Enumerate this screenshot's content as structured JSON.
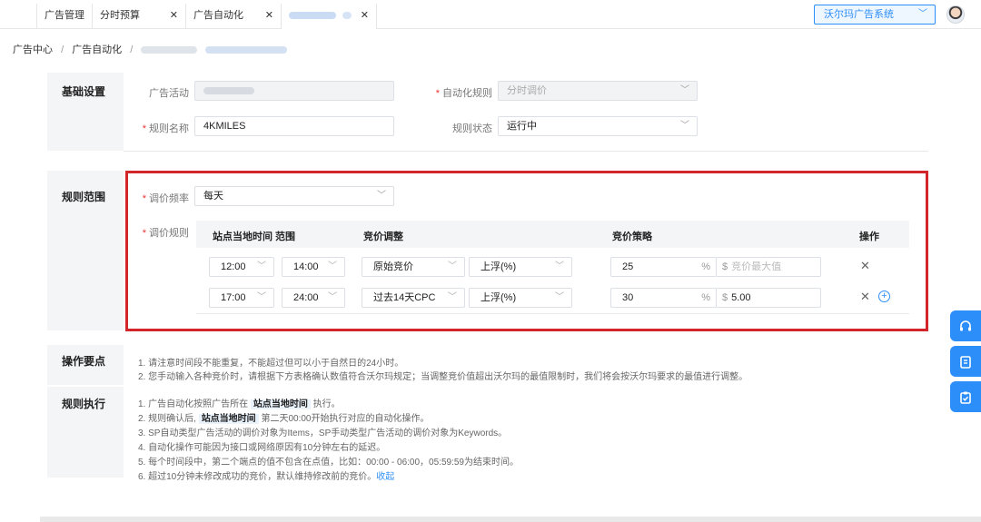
{
  "tabs": [
    {
      "label": "广告管理",
      "closable": false
    },
    {
      "label": "分时预算",
      "closable": true
    },
    {
      "label": "广告自动化",
      "closable": true
    },
    {
      "label": "",
      "closable": true,
      "blurred": true
    }
  ],
  "system_select": {
    "value": "沃尔玛广告系统"
  },
  "breadcrumb": {
    "items": [
      "广告中心",
      "广告自动化"
    ],
    "separator": "/"
  },
  "basic": {
    "section_title": "基础设置",
    "campaign_label": "广告活动",
    "rule_type_label": "自动化规则",
    "rule_type_value": "分时调价",
    "rule_name_label": "规则名称",
    "rule_name_value": "4KMILES",
    "rule_status_label": "规则状态",
    "rule_status_value": "运行中"
  },
  "scope": {
    "section_title": "规则范围",
    "freq_label": "调价频率",
    "freq_value": "每天",
    "rules_label": "调价规则",
    "columns": [
      "站点当地时间 范围",
      "竞价调整",
      "竞价策略",
      "操作"
    ],
    "rows": [
      {
        "start": "12:00",
        "end": "14:00",
        "base": "原始竞价",
        "direction": "上浮(%)",
        "percent": "25",
        "percent_unit": "%",
        "currency": "$",
        "cap_placeholder": "竞价最大值",
        "cap_value": ""
      },
      {
        "start": "17:00",
        "end": "24:00",
        "base": "过去14天CPC",
        "direction": "上浮(%)",
        "percent": "30",
        "percent_unit": "%",
        "currency": "$",
        "cap_placeholder": "",
        "cap_value": "5.00"
      }
    ]
  },
  "ops": {
    "section_title": "操作要点",
    "notes": [
      "1. 请注意时间段不能重复，不能超过但可以小于自然日的24小时。",
      "2. 您手动输入各种竞价时，请根据下方表格确认数值符合沃尔玛规定；当调整竞价值超出沃尔玛的最值限制时，我们将会按沃尔玛要求的最值进行调整。"
    ]
  },
  "exec": {
    "section_title": "规则执行",
    "line1_pre": "1. 广告自动化按照广告所在",
    "line1_hl": "站点当地时间",
    "line1_post": "执行。",
    "line2_pre": "2. 规则确认后,",
    "line2_hl": "站点当地时间",
    "line2_post": "第二天00:00开始执行对应的自动化操作。",
    "line3": "3. SP自动类型广告活动的调价对象为Items，SP手动类型广告活动的调价对象为Keywords。",
    "line4": "4. 自动化操作可能因为接口或网络原因有10分钟左右的延迟。",
    "line5": "5. 每个时间段中，第二个端点的值不包含在点值，比如：00:00 - 06:00，05:59:59为结束时间。",
    "line6_pre": "6. 超过10分钟未修改成功的竞价，默认维持修改前的竞价。",
    "line6_link": "收起"
  },
  "icons": {
    "float_buttons": [
      "headset-icon",
      "book-icon",
      "clipboard-icon"
    ]
  },
  "colors": {
    "accent": "#2c8ef8",
    "highlight": "#d3262b"
  }
}
